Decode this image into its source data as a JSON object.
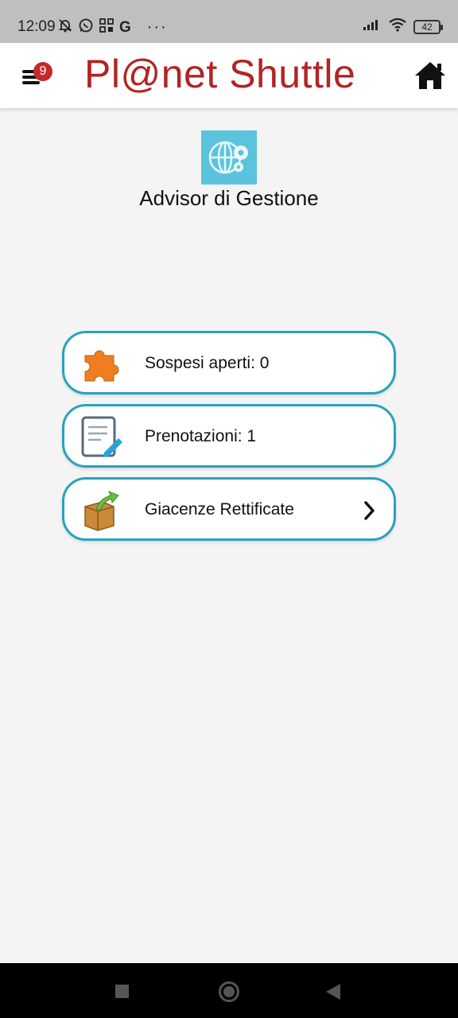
{
  "status_bar": {
    "time": "12:09",
    "left_icons": [
      "muted-bell-icon",
      "whatsapp-icon",
      "qr-icon",
      "google-icon"
    ],
    "google_letter": "G",
    "more": "···",
    "battery_level": "42"
  },
  "header": {
    "badge_count": "9",
    "brand": "Pl@net Shuttle",
    "brand_color": "#b22424"
  },
  "page": {
    "title": "Advisor di Gestione"
  },
  "cards": [
    {
      "label": "Sospesi aperti: 0",
      "icon": "puzzle-icon",
      "has_chevron": false
    },
    {
      "label": "Prenotazioni: 1",
      "icon": "notepad-edit-icon",
      "has_chevron": false
    },
    {
      "label": "Giacenze Rettificate",
      "icon": "box-arrow-icon",
      "has_chevron": true
    }
  ],
  "colors": {
    "accent": "#27a3bd",
    "logo_bg": "#5bc4dc",
    "badge": "#c62828"
  }
}
